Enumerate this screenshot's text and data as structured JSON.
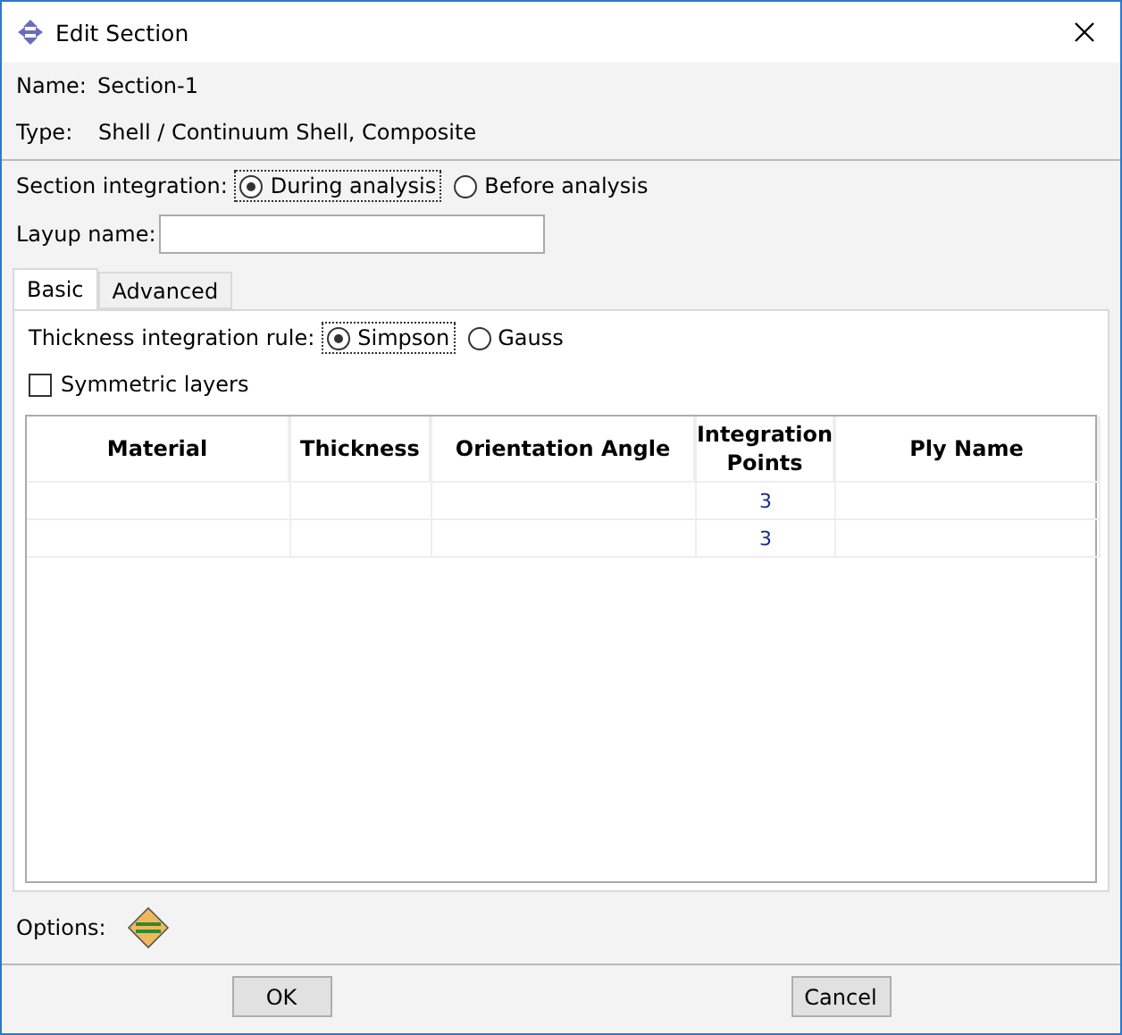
{
  "window": {
    "title": "Edit Section"
  },
  "name": {
    "label": "Name:",
    "value": "Section-1"
  },
  "type": {
    "label": "Type:",
    "value": "Shell / Continuum Shell, Composite"
  },
  "section_integration": {
    "label": "Section integration:",
    "options": [
      {
        "label": "During analysis",
        "selected": true
      },
      {
        "label": "Before analysis",
        "selected": false
      }
    ]
  },
  "layup_name": {
    "label": "Layup name:"
  },
  "tabs": [
    {
      "label": "Basic",
      "selected": true
    },
    {
      "label": "Advanced",
      "selected": false
    }
  ],
  "thickness_rule": {
    "label": "Thickness integration rule:",
    "options": [
      {
        "label": "Simpson",
        "selected": true
      },
      {
        "label": "Gauss",
        "selected": false
      }
    ]
  },
  "symmetric_layers": {
    "label": "Symmetric layers",
    "checked": false
  },
  "table": {
    "columns": [
      "Material",
      "Thickness",
      "Orientation Angle",
      "Integration Points",
      "Ply Name"
    ],
    "rows": [
      [
        "",
        "",
        "",
        "3",
        ""
      ],
      [
        "",
        "",
        "",
        "3",
        ""
      ]
    ]
  },
  "options": {
    "label": "Options:"
  },
  "buttons": [
    "OK",
    "Cancel"
  ]
}
